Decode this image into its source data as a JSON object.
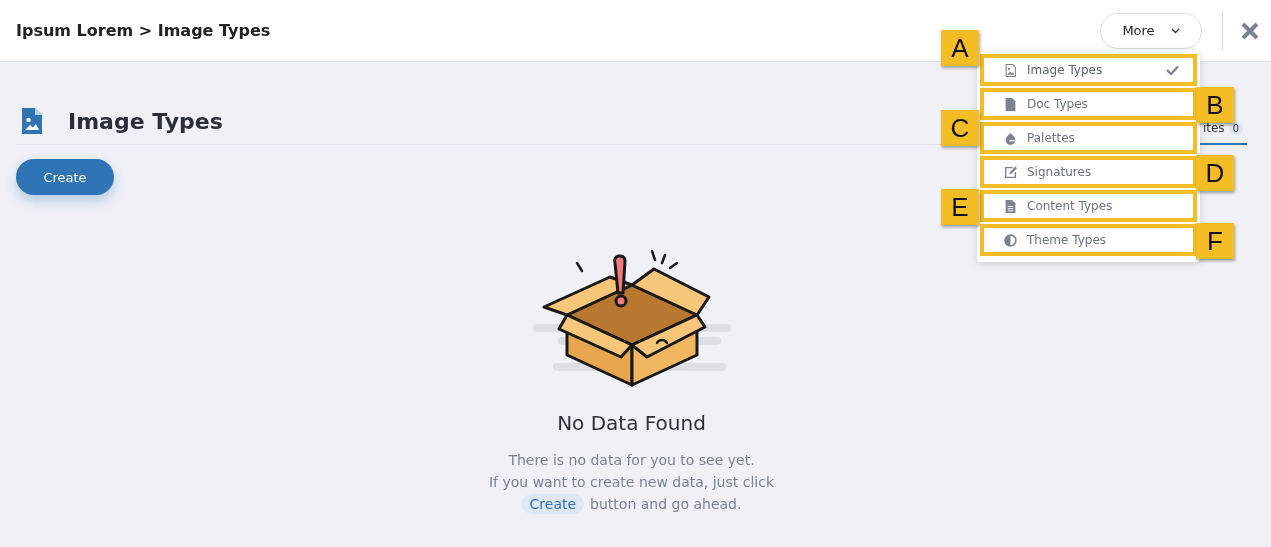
{
  "header": {
    "breadcrumb": "Ipsum Lorem > Image Types",
    "more_button": "More"
  },
  "page": {
    "title": "Image Types",
    "create_button": "Create",
    "tab": {
      "label": "ites",
      "badge": "0",
      "selected": true
    }
  },
  "empty_state": {
    "title": "No Data Found",
    "lines": [
      "There is no data for you to see yet.",
      "If you want to create new data, just click"
    ],
    "inline_button": "Create",
    "after_button": "button and go ahead."
  },
  "menu": [
    {
      "label": "Image Types",
      "kind": "image",
      "selected": true,
      "callout": "A"
    },
    {
      "label": "Doc Types",
      "kind": "doc",
      "selected": false,
      "callout": "B"
    },
    {
      "label": "Palettes",
      "kind": "drop",
      "selected": false,
      "callout": "C"
    },
    {
      "label": "Signatures",
      "kind": "edit",
      "selected": false,
      "callout": "D"
    },
    {
      "label": "Content Types",
      "kind": "text",
      "selected": false,
      "callout": "E"
    },
    {
      "label": "Theme Types",
      "kind": "contrast",
      "selected": false,
      "callout": "F"
    }
  ]
}
